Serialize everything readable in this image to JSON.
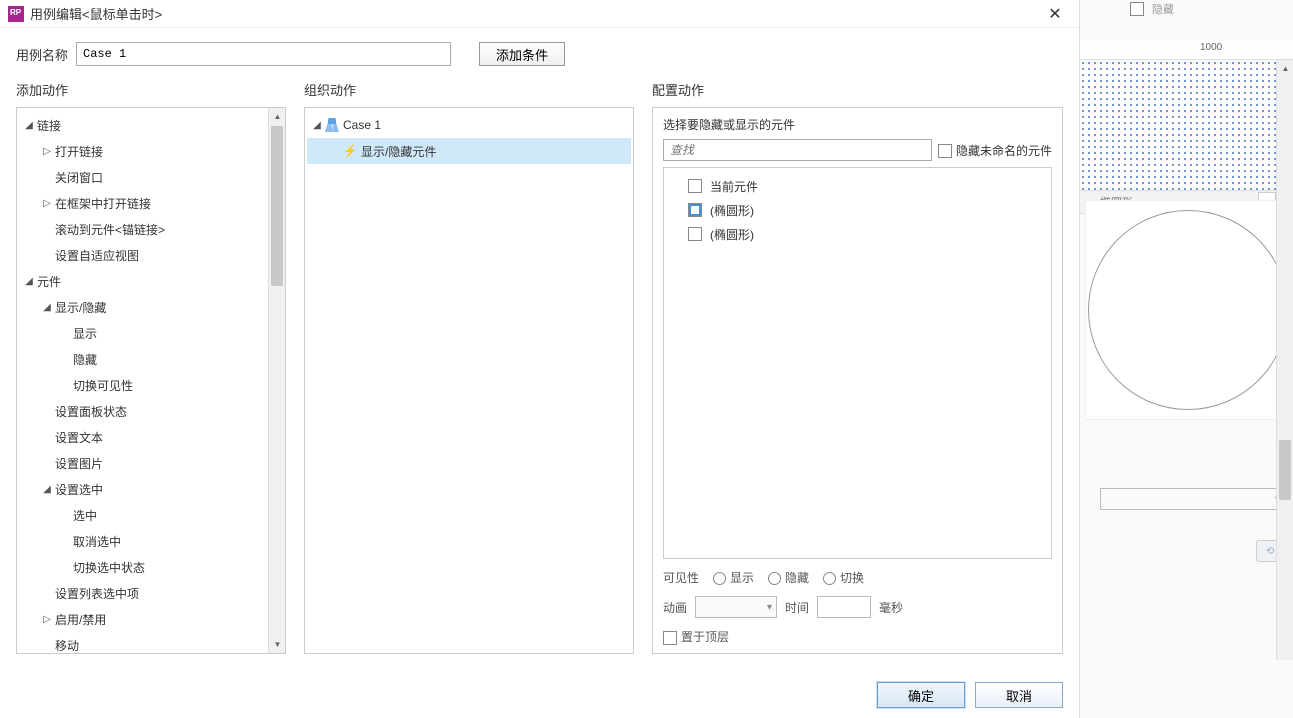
{
  "titlebar": {
    "text": "用例编辑<鼠标单击时>"
  },
  "name_row": {
    "label": "用例名称",
    "value": "Case 1",
    "add_condition": "添加条件"
  },
  "sections": {
    "add_action": "添加动作",
    "organize": "组织动作",
    "configure": "配置动作"
  },
  "add_tree": {
    "links": "链接",
    "open_link": "打开链接",
    "close_window": "关闭窗口",
    "open_in_frame": "在框架中打开链接",
    "scroll_to": "滚动到元件<锚链接>",
    "adaptive": "设置自适应视图",
    "widgets": "元件",
    "show_hide": "显示/隐藏",
    "show": "显示",
    "hide": "隐藏",
    "toggle_vis": "切换可见性",
    "panel_state": "设置面板状态",
    "set_text": "设置文本",
    "set_image": "设置图片",
    "set_selected": "设置选中",
    "select": "选中",
    "deselect": "取消选中",
    "toggle_sel": "切换选中状态",
    "list_select": "设置列表选中项",
    "enable_disable": "启用/禁用",
    "move": "移动"
  },
  "org_tree": {
    "case": "Case 1",
    "action": "显示/隐藏元件"
  },
  "configure": {
    "pick_title": "选择要隐藏或显示的元件",
    "search_placeholder": "查找",
    "hide_unnamed": "隐藏未命名的元件",
    "items": {
      "current": "当前元件",
      "ellipse1": "(椭圆形)",
      "ellipse2": "(椭圆形)"
    },
    "visibility_label": "可见性",
    "vis_show": "显示",
    "vis_hide": "隐藏",
    "vis_toggle": "切换",
    "anim_label": "动画",
    "time_label": "时间",
    "ms_label": "毫秒",
    "bring_front": "置于顶层"
  },
  "footer": {
    "ok": "确定",
    "cancel": "取消"
  },
  "bg": {
    "ruler_1000": "1000",
    "tab_label": "椭圆形",
    "hidden_label": "隐藏"
  }
}
